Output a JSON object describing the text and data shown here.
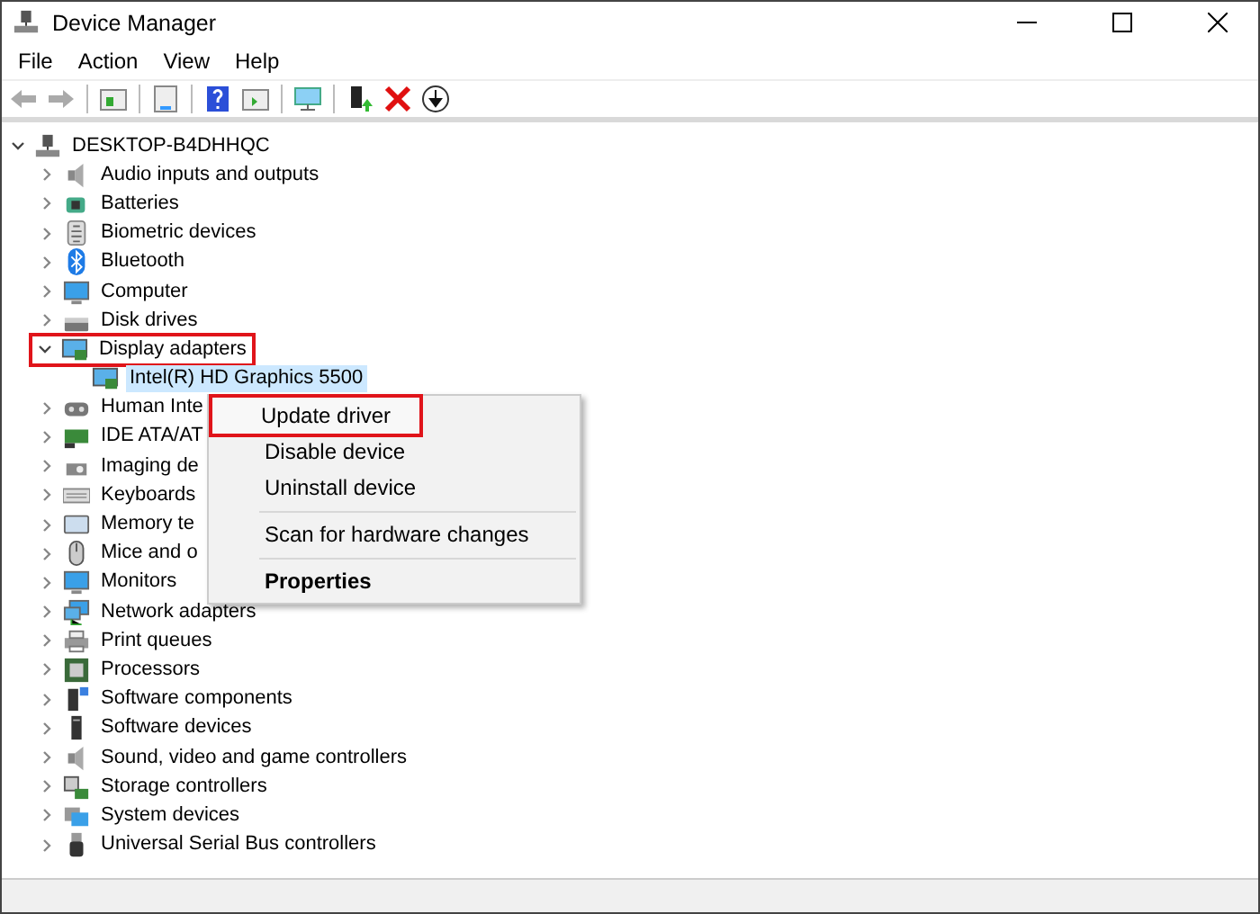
{
  "window": {
    "title": "Device Manager"
  },
  "menu_bar": [
    "File",
    "Action",
    "View",
    "Help"
  ],
  "tree": {
    "label": "DESKTOP-B4DHHQC",
    "expanded": true,
    "selected": false,
    "children": [
      {
        "label": "Audio inputs and outputs",
        "expanded": false,
        "selected": false,
        "highlighted": false
      },
      {
        "label": "Batteries",
        "expanded": false,
        "selected": false,
        "highlighted": false
      },
      {
        "label": "Biometric devices",
        "expanded": false,
        "selected": false,
        "highlighted": false
      },
      {
        "label": "Bluetooth",
        "expanded": false,
        "selected": false,
        "highlighted": false
      },
      {
        "label": "Computer",
        "expanded": false,
        "selected": false,
        "highlighted": false
      },
      {
        "label": "Disk drives",
        "expanded": false,
        "selected": false,
        "highlighted": false
      },
      {
        "label": "Display adapters",
        "expanded": true,
        "selected": false,
        "highlighted": true,
        "children": [
          {
            "label": "Intel(R) HD Graphics 5500",
            "selected": true
          }
        ]
      },
      {
        "label": "Human Inte",
        "expanded": false,
        "selected": false,
        "highlighted": false
      },
      {
        "label": "IDE ATA/AT",
        "expanded": false,
        "selected": false,
        "highlighted": false
      },
      {
        "label": "Imaging de",
        "expanded": false,
        "selected": false,
        "highlighted": false
      },
      {
        "label": "Keyboards",
        "expanded": false,
        "selected": false,
        "highlighted": false
      },
      {
        "label": "Memory te",
        "expanded": false,
        "selected": false,
        "highlighted": false
      },
      {
        "label": "Mice and o",
        "expanded": false,
        "selected": false,
        "highlighted": false
      },
      {
        "label": "Monitors",
        "expanded": false,
        "selected": false,
        "highlighted": false
      },
      {
        "label": "Network adapters",
        "expanded": false,
        "selected": false,
        "highlighted": false
      },
      {
        "label": "Print queues",
        "expanded": false,
        "selected": false,
        "highlighted": false
      },
      {
        "label": "Processors",
        "expanded": false,
        "selected": false,
        "highlighted": false
      },
      {
        "label": "Software components",
        "expanded": false,
        "selected": false,
        "highlighted": false
      },
      {
        "label": "Software devices",
        "expanded": false,
        "selected": false,
        "highlighted": false
      },
      {
        "label": "Sound, video and game controllers",
        "expanded": false,
        "selected": false,
        "highlighted": false
      },
      {
        "label": "Storage controllers",
        "expanded": false,
        "selected": false,
        "highlighted": false
      },
      {
        "label": "System devices",
        "expanded": false,
        "selected": false,
        "highlighted": false
      },
      {
        "label": "Universal Serial Bus controllers",
        "expanded": false,
        "selected": false,
        "highlighted": false
      }
    ]
  },
  "context_menu": {
    "items": [
      {
        "kind": "item",
        "label": "Update driver",
        "highlighted": true,
        "default": false
      },
      {
        "kind": "item",
        "label": "Disable device",
        "highlighted": false,
        "default": false
      },
      {
        "kind": "item",
        "label": "Uninstall device",
        "highlighted": false,
        "default": false
      },
      {
        "kind": "separator"
      },
      {
        "kind": "item",
        "label": "Scan for hardware changes",
        "highlighted": false,
        "default": false
      },
      {
        "kind": "separator"
      },
      {
        "kind": "item",
        "label": "Properties",
        "highlighted": false,
        "default": true
      }
    ]
  }
}
